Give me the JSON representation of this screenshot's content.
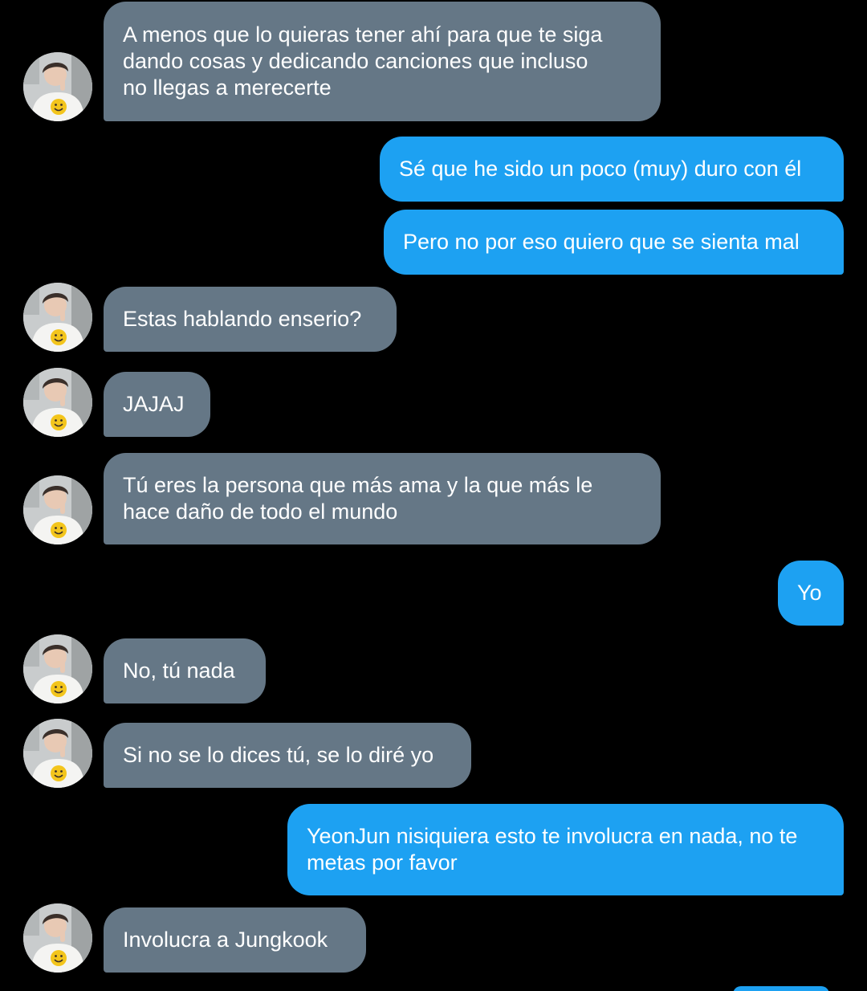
{
  "colors": {
    "background": "#000000",
    "received_bubble": "#657786",
    "sent_bubble": "#1da1f2",
    "text": "#ffffff"
  },
  "avatar": {
    "icon": "profile-photo-smiley-shirt"
  },
  "messages": [
    {
      "direction": "received",
      "text": "A menos que lo quieras tener ahí para que te siga\ndando cosas y dedicando canciones que incluso\nno llegas a merecerte"
    },
    {
      "direction": "sent",
      "text": "Sé que he sido un poco (muy) duro con él"
    },
    {
      "direction": "sent",
      "text": "Pero no por eso quiero que se sienta mal"
    },
    {
      "direction": "received",
      "text": "Estas hablando enserio?"
    },
    {
      "direction": "received",
      "text": "JAJAJ"
    },
    {
      "direction": "received",
      "text": "Tú eres la persona que más ama y la que más le\nhace daño de todo el mundo"
    },
    {
      "direction": "sent",
      "text": "Yo"
    },
    {
      "direction": "received",
      "text": "No, tú nada"
    },
    {
      "direction": "received",
      "text": "Si no se lo dices tú, se lo diré yo"
    },
    {
      "direction": "sent",
      "text": "YeonJun nisiquiera esto te involucra en nada, no te\nmetas por favor"
    },
    {
      "direction": "received",
      "text": "Involucra a Jungkook"
    }
  ]
}
